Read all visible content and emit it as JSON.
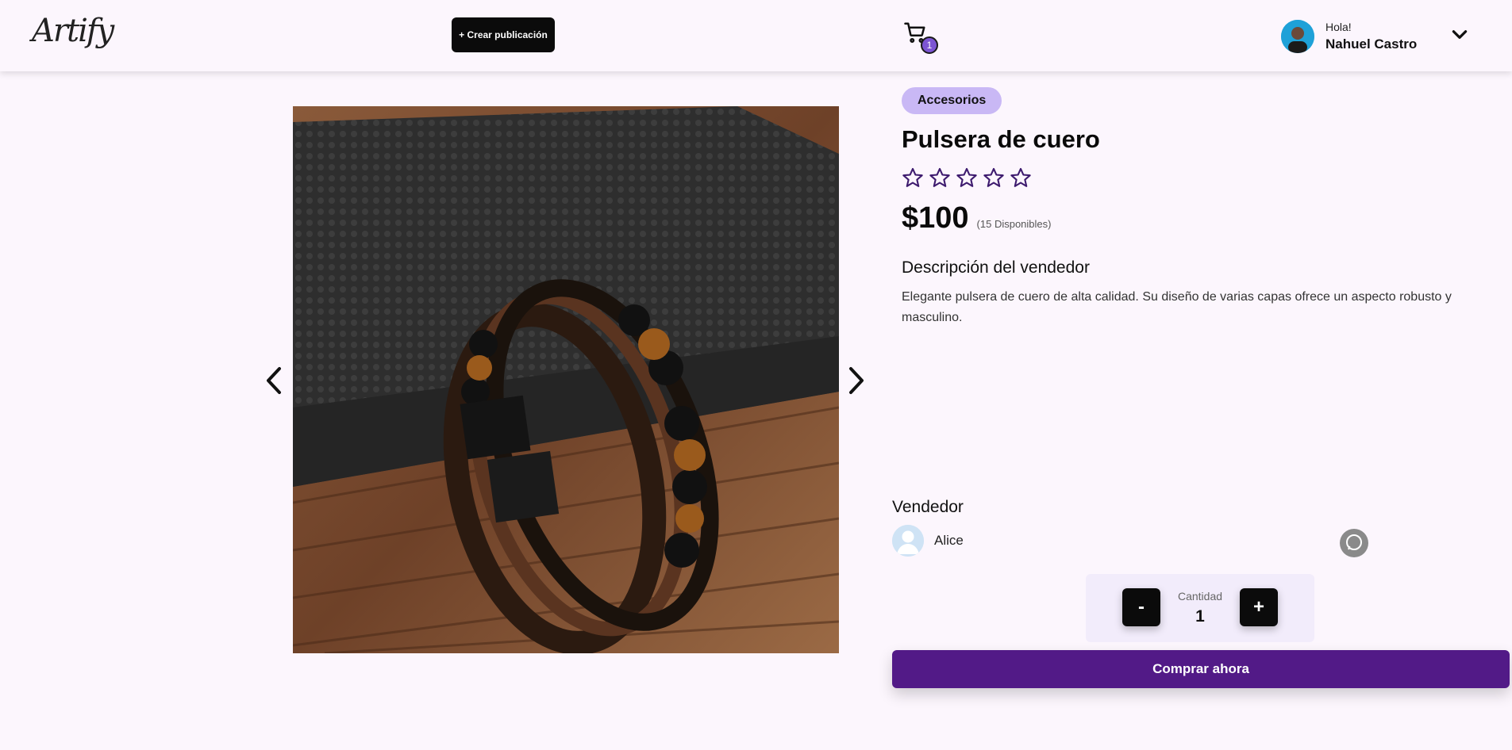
{
  "header": {
    "logo_text": "Artify",
    "create_label": "+ Crear publicación",
    "cart_count": "1",
    "greeting": "Hola!",
    "user_name": "Nahuel Castro"
  },
  "product": {
    "category": "Accesorios",
    "title": "Pulsera de cuero",
    "rating": 0,
    "rating_max": 5,
    "price": "$100",
    "stock": "(15 Disponibles)",
    "description_title": "Descripción del vendedor",
    "description": "Elegante pulsera de cuero de alta calidad. Su diseño de varias capas ofrece un aspecto robusto y masculino.",
    "image_icon": "leather-bracelet-photo"
  },
  "seller": {
    "title": "Vendedor",
    "name": "Alice",
    "contact_icon": "whatsapp-icon"
  },
  "purchase": {
    "minus_label": "-",
    "plus_label": "+",
    "quantity_label": "Cantidad",
    "quantity_value": "1",
    "buy_label": "Comprar ahora"
  },
  "colors": {
    "accent": "#521a87",
    "category_bg": "#c9b8f5",
    "star": "#3d1a6e",
    "background": "#fcf6fd"
  }
}
